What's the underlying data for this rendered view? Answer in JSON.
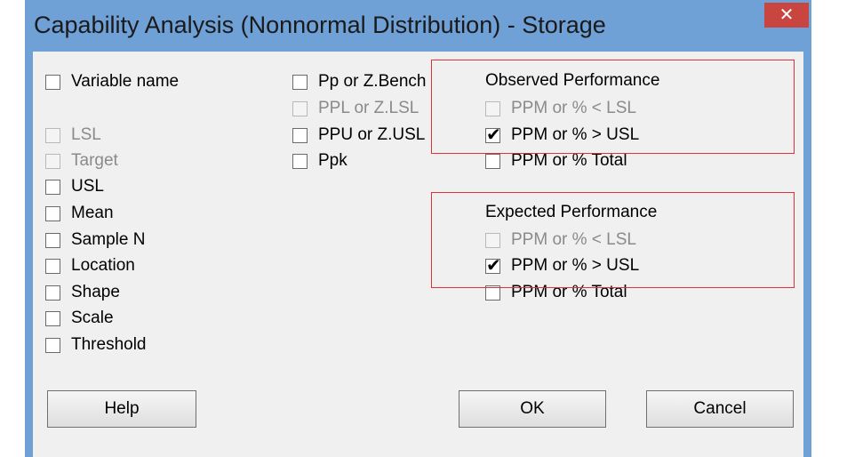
{
  "window": {
    "title": "Capability Analysis (Nonnormal Distribution) - Storage",
    "close_glyph": "✕"
  },
  "left_column": [
    {
      "label": "Variable name",
      "checked": false,
      "enabled": true
    },
    {
      "label": "LSL",
      "checked": false,
      "enabled": false
    },
    {
      "label": "Target",
      "checked": false,
      "enabled": false
    },
    {
      "label": "USL",
      "checked": false,
      "enabled": true
    },
    {
      "label": "Mean",
      "checked": false,
      "enabled": true
    },
    {
      "label": "Sample N",
      "checked": false,
      "enabled": true
    },
    {
      "label": "Location",
      "checked": false,
      "enabled": true
    },
    {
      "label": "Shape",
      "checked": false,
      "enabled": true
    },
    {
      "label": "Scale",
      "checked": false,
      "enabled": true
    },
    {
      "label": "Threshold",
      "checked": false,
      "enabled": true
    }
  ],
  "middle_column": [
    {
      "label": "Pp or Z.Bench",
      "checked": false,
      "enabled": true
    },
    {
      "label": "PPL or Z.LSL",
      "checked": false,
      "enabled": false
    },
    {
      "label": "PPU or Z.USL",
      "checked": false,
      "enabled": true
    },
    {
      "label": "Ppk",
      "checked": false,
      "enabled": true
    }
  ],
  "observed": {
    "heading": "Observed Performance",
    "items": [
      {
        "label": "PPM or % < LSL",
        "checked": false,
        "enabled": false
      },
      {
        "label": "PPM or % > USL",
        "checked": true,
        "enabled": true
      },
      {
        "label": "PPM or % Total",
        "checked": false,
        "enabled": true
      }
    ]
  },
  "expected": {
    "heading": "Expected Performance",
    "items": [
      {
        "label": "PPM or % < LSL",
        "checked": false,
        "enabled": false
      },
      {
        "label": "PPM or % > USL",
        "checked": true,
        "enabled": true
      },
      {
        "label": "PPM or % Total",
        "checked": false,
        "enabled": true
      }
    ]
  },
  "buttons": {
    "help": "Help",
    "ok": "OK",
    "cancel": "Cancel"
  },
  "check_glyph": "✔",
  "colors": {
    "title_bar": "#6fa0d6",
    "close_button": "#c8463f",
    "highlight_box": "#e0313a",
    "client_bg": "#f0f0f0"
  }
}
